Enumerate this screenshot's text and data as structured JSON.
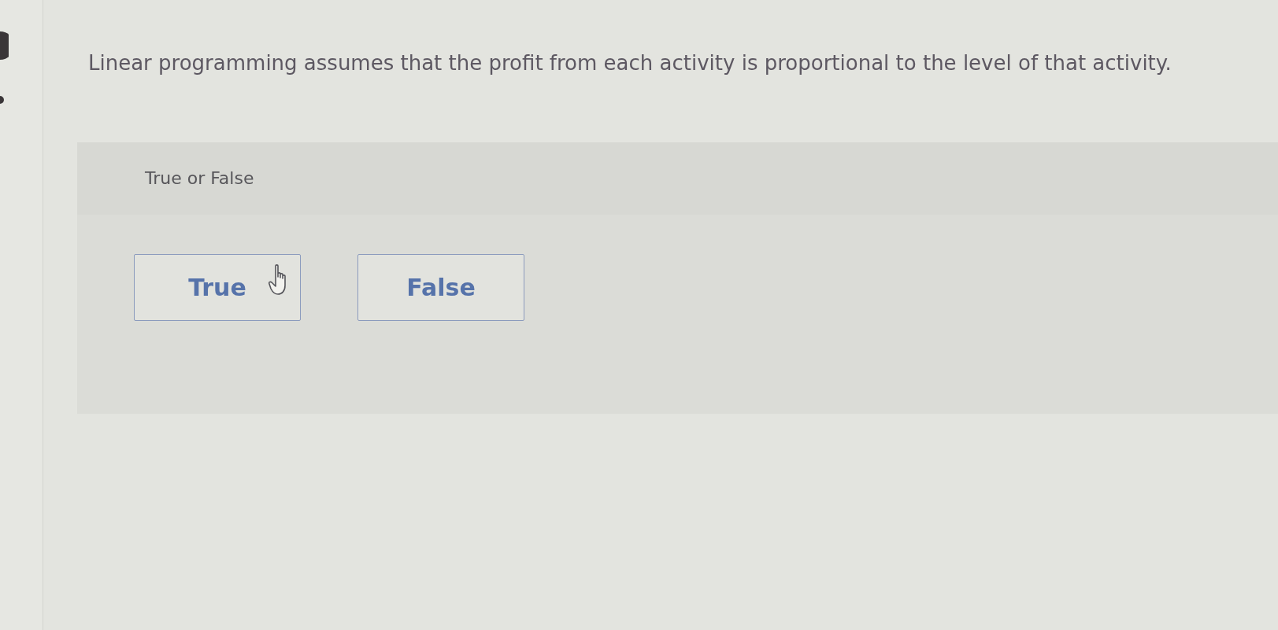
{
  "question": {
    "text": "Linear programming assumes that the profit from each activity is proportional to the level of that activity."
  },
  "prompt": {
    "text": "True or False"
  },
  "options": [
    {
      "label": "True",
      "selected": false,
      "hovered": true
    },
    {
      "label": "False",
      "selected": false,
      "hovered": false
    }
  ]
}
